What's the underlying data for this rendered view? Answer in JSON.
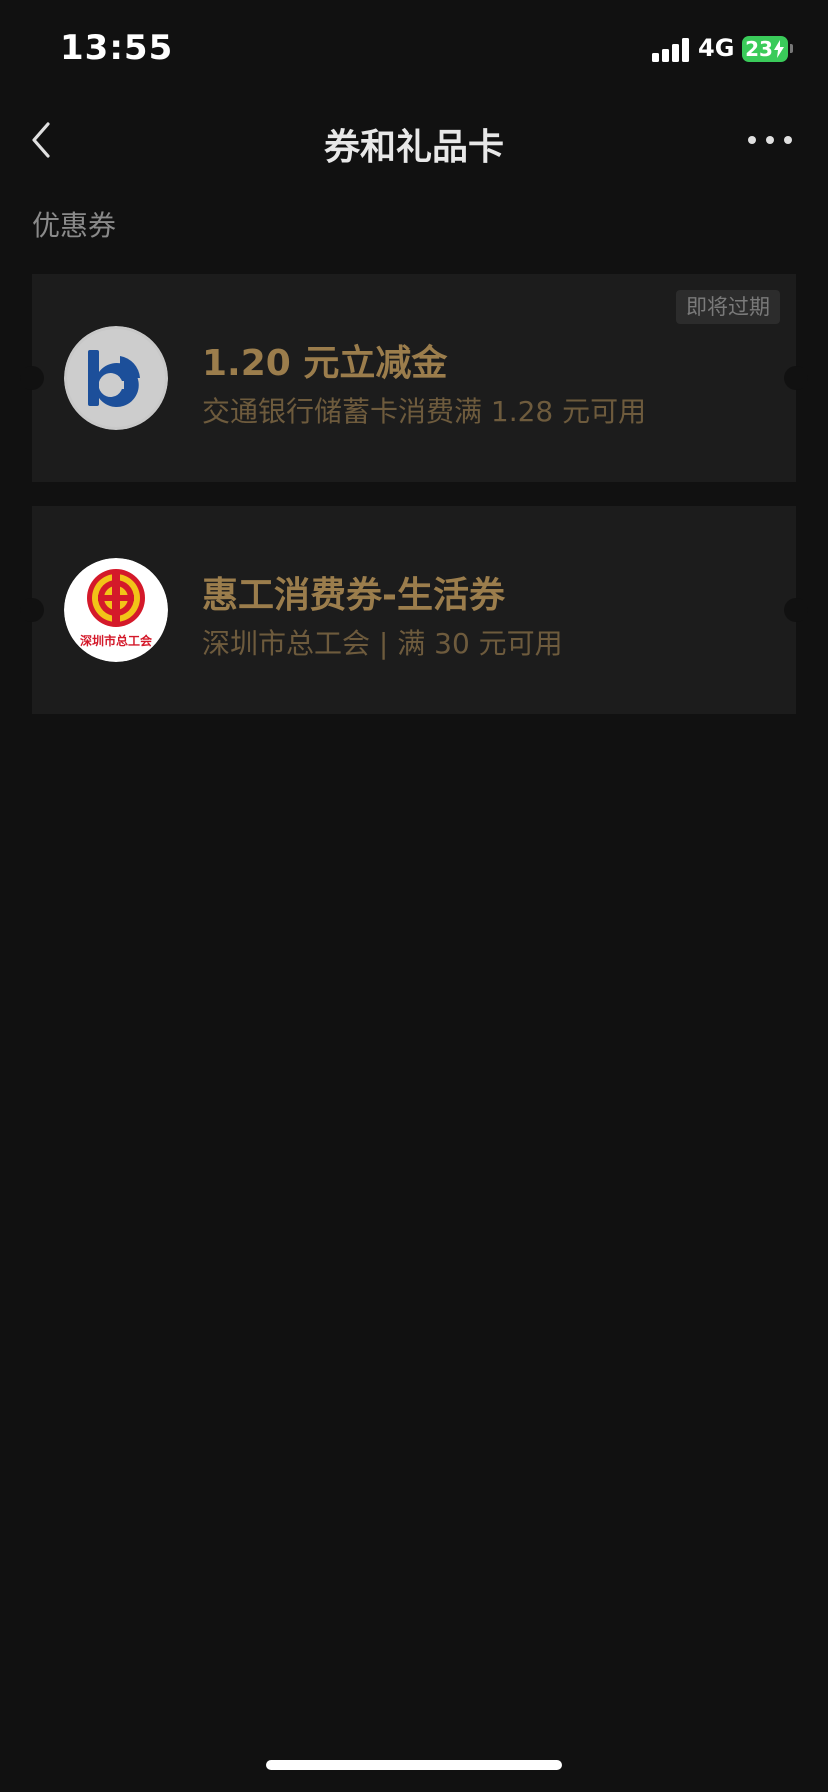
{
  "status_bar": {
    "time": "13:55",
    "network": "4G",
    "battery": "23"
  },
  "nav": {
    "title": "券和礼品卡",
    "back_icon": "chevron-left-icon",
    "more_icon": "more-dots-icon"
  },
  "section": {
    "title": "优惠券"
  },
  "coupons": [
    {
      "title": "1.20 元立减金",
      "description": "交通银行储蓄卡消费满 1.28 元可用",
      "badge": "即将过期",
      "logo": "bocom-logo"
    },
    {
      "title": "惠工消费券-生活券",
      "description": "深圳市总工会 | 满 30 元可用",
      "logo": "shenzhen-federation-of-trade-unions-logo",
      "logo_text": "深圳市总工会"
    }
  ],
  "colors": {
    "background": "#111111",
    "card": "#1c1c1c",
    "coupon_title": "#9b7d4c",
    "coupon_desc": "#6e5b3d",
    "battery": "#3acb5a"
  }
}
